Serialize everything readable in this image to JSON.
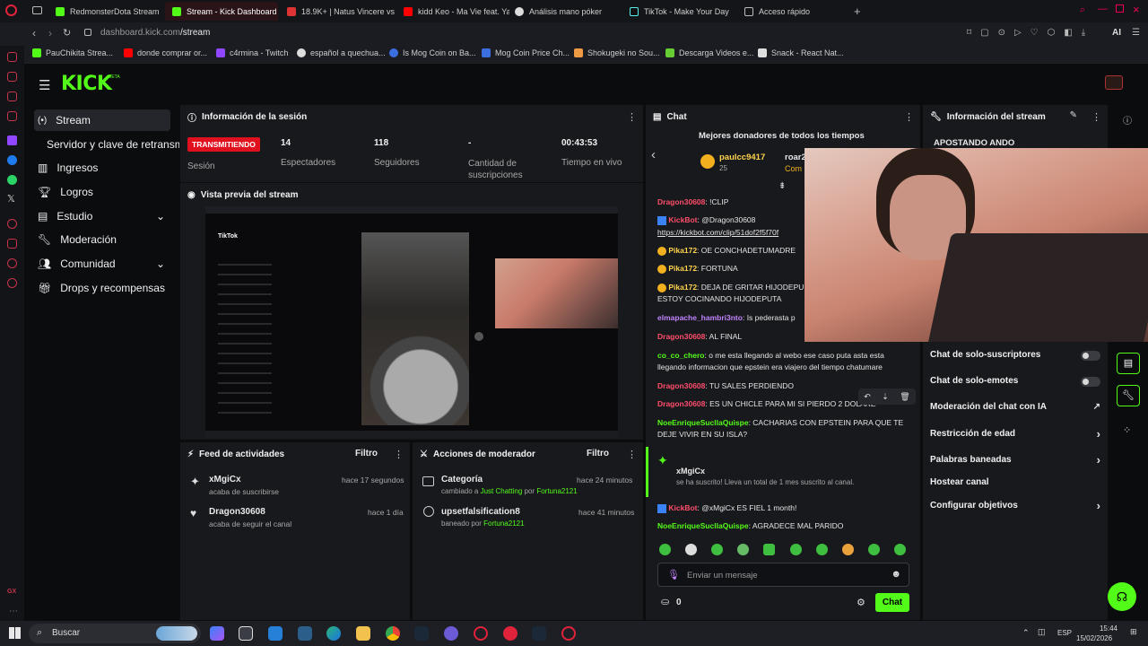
{
  "colors": {
    "accent": "#53fc18",
    "live": "#e1101f",
    "bg": "#0b0c0e",
    "panel": "#18191d"
  },
  "browser": {
    "tabs": [
      {
        "title": "RedmonsterDota Stream",
        "icon": "kick-icon"
      },
      {
        "title": "Stream - Kick Dashboard",
        "icon": "kick-icon",
        "active": true
      },
      {
        "title": "18.9K+ | Natus Vincere vs",
        "icon": "game-icon"
      },
      {
        "title": "kidd Keo - Ma Vie feat. Ya",
        "icon": "youtube-icon"
      },
      {
        "title": "Análisis mano póker",
        "icon": "chatgpt-icon"
      },
      {
        "title": "TikTok - Make Your Day",
        "icon": "tiktok-icon"
      },
      {
        "title": "Acceso rápido",
        "icon": "grid-icon"
      }
    ],
    "url_host": "dashboard.kick.com",
    "url_path": "/stream",
    "ai_label": "AI",
    "bookmarks": [
      "PauChikita Strea...",
      "donde comprar or...",
      "c4rmina - Twitch",
      "español a quechua...",
      "Is Mog Coin on Ba...",
      "Mog Coin Price Ch...",
      "Shokugeki no Sou...",
      "Descarga Videos e...",
      "Snack - React Nat..."
    ]
  },
  "app": {
    "logo": "KICK",
    "logo_badge": "BETA",
    "nav": [
      {
        "label": "Stream",
        "icon": "broadcast-icon"
      },
      {
        "label": "Servidor y clave de retransmi",
        "icon": ""
      },
      {
        "label": "Ingresos",
        "icon": "chart-icon"
      },
      {
        "label": "Logros",
        "icon": "trophy-icon"
      },
      {
        "label": "Estudio",
        "icon": "studio-icon"
      },
      {
        "label": "Moderación",
        "icon": "wrench-icon"
      },
      {
        "label": "Comunidad",
        "icon": "community-icon"
      },
      {
        "label": "Drops y recompensas",
        "icon": "gift-icon"
      }
    ]
  },
  "session": {
    "title": "Información de la sesión",
    "live_badge": "TRANSMITIENDO",
    "session_label": "Sesión",
    "viewers": "14",
    "viewers_label": "Espectadores",
    "followers": "118",
    "followers_label": "Seguidores",
    "subs": "-",
    "subs_label": "Cantidad de suscripciones",
    "uptime": "00:43:53",
    "uptime_label": "Tiempo en vivo"
  },
  "preview": {
    "title": "Vista previa del stream",
    "tiktok": "TikTok"
  },
  "activity": {
    "title": "Feed de actividades",
    "filter": "Filtro",
    "items": [
      {
        "user": "xMgiCx",
        "action": "acaba de suscribirse",
        "time": "hace 17 segundos",
        "icon": "sparkle-icon"
      },
      {
        "user": "Dragon30608",
        "action": "acaba de seguir el canal",
        "time": "hace 1 día",
        "icon": "heart-icon"
      }
    ]
  },
  "modactions": {
    "title": "Acciones de moderador",
    "filter": "Filtro",
    "items": [
      {
        "title": "Categoría",
        "pre": "cambiado a",
        "target": "Just Chatting",
        "mid": "por",
        "actor": "Fortuna2121",
        "time": "hace 24 minutos",
        "icon": "category-icon"
      },
      {
        "title": "upsetfalsification8",
        "pre": "baneado por",
        "target": "",
        "mid": "",
        "actor": "Fortuna2121",
        "time": "hace 41 minutos",
        "icon": "ban-icon"
      }
    ]
  },
  "chat": {
    "title": "Chat",
    "donors_title": "Mejores donadores de todos los tiempos",
    "donor1": "paulcc9417",
    "donor1_amount": "25",
    "donor2": "roar2",
    "donor2_tag": "Com",
    "messages": [
      {
        "user": "Dragon30608",
        "color": "#ff4d6a",
        "text": "!CLIP"
      },
      {
        "user": "KickBot",
        "color": "#ff4d6a",
        "text": "@Dragon30608",
        "bot": true
      },
      {
        "user": "",
        "color": "#e4e4e4",
        "text": "https://kickbot.com/clip/51dof2f5f70f"
      },
      {
        "user": "Pika172",
        "color": "#ffd34d",
        "text": "OE CONCHADETUMADRE"
      },
      {
        "user": "Pika172",
        "color": "#ffd34d",
        "text": "FORTUNA"
      },
      {
        "user": "Pika172",
        "color": "#ffd34d",
        "text": "DEJA DE GRITAR HIJODEPU ESTOY COCINANDO HIJODEPUTA"
      },
      {
        "user": "elmapache_hambri3nto",
        "color": "#c084fc",
        "text": "Is pederasta p"
      },
      {
        "user": "Dragon30608",
        "color": "#ff4d6a",
        "text": "AL FINAL"
      },
      {
        "user": "co_co_chero",
        "color": "#53fc18",
        "text": "o me esta llegando al webo ese caso puta asta esta llegando informacion que epstein era viajero del tiempo chatumare"
      },
      {
        "user": "Dragon30608",
        "color": "#ff4d6a",
        "text": "TU SALES PERDIENDO"
      },
      {
        "user": "Dragon30608",
        "color": "#ff4d6a",
        "text": "ES UN CHICLE PARA MI SI PIERDO 2 DOLARE"
      },
      {
        "user": "NoeEnriqueSucllaQuispe",
        "color": "#53fc18",
        "text": "CACHARIAS CON EPSTEIN PARA QUE TE DEJE VIVIR EN SU ISLA?"
      }
    ],
    "sub_user": "xMgiCx",
    "sub_text": "se ha suscrito! Lleva un total de 1 mes suscrito al canal.",
    "after": [
      {
        "user": "KickBot",
        "color": "#ff4d6a",
        "text": "@xMgiCx ES FIEL 1 month!"
      },
      {
        "user": "NoeEnriqueSucllaQuispe",
        "color": "#53fc18",
        "text": "AGRADECE MAL PARIDO"
      }
    ],
    "input_placeholder": "Enviar un mensaje",
    "points": "0",
    "send": "Chat"
  },
  "streaminfo": {
    "title": "Información del stream",
    "stream_title": "APOSTANDO ANDO",
    "settings": [
      {
        "label": "Chat de solo-suscriptores",
        "type": "toggle"
      },
      {
        "label": "Chat de solo-emotes",
        "type": "toggle"
      },
      {
        "label": "Moderación del chat con IA",
        "type": "link"
      },
      {
        "label": "Restricción de edad",
        "type": "chevron"
      },
      {
        "label": "Palabras baneadas",
        "type": "chevron"
      },
      {
        "label": "Hostear canal",
        "type": "none"
      },
      {
        "label": "Configurar objetivos",
        "type": "chevron"
      }
    ]
  },
  "taskbar": {
    "search": "Buscar",
    "lang": "ESP",
    "time": "15:44",
    "date": "15/02/2026"
  }
}
